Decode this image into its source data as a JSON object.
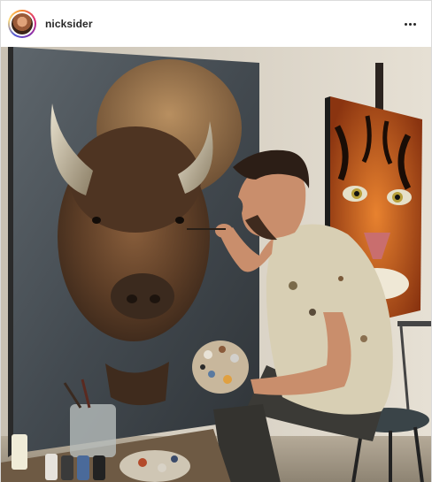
{
  "post": {
    "username": "nicksider",
    "menu_icon": "more-horizontal-icon",
    "photo_icon": "post-photo"
  },
  "colors": {
    "wall": "#d9d2c6",
    "canvas_bg": "#4b5258",
    "bison_fur": "#6b4a30",
    "tiger_orange": "#d0621f",
    "shirt": "#d8cfb4"
  }
}
